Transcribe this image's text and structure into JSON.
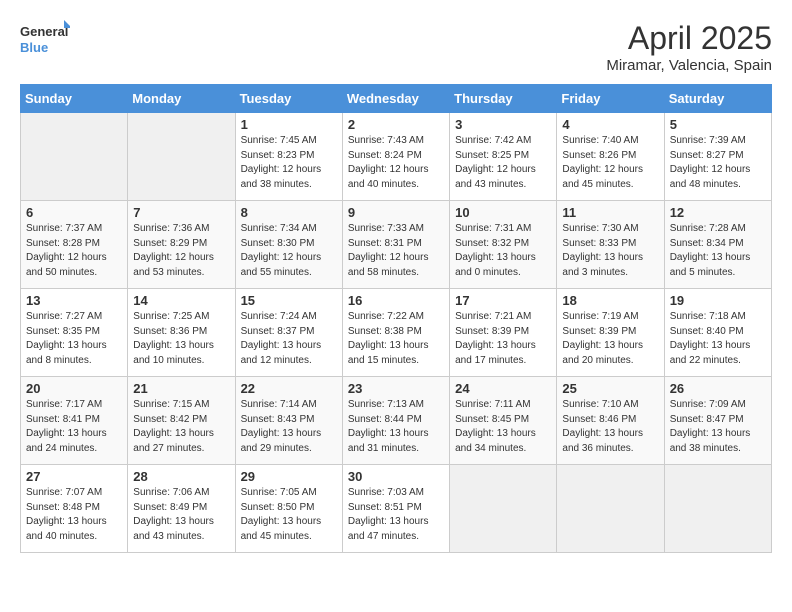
{
  "header": {
    "logo_general": "General",
    "logo_blue": "Blue",
    "month": "April 2025",
    "location": "Miramar, Valencia, Spain"
  },
  "days_of_week": [
    "Sunday",
    "Monday",
    "Tuesday",
    "Wednesday",
    "Thursday",
    "Friday",
    "Saturday"
  ],
  "weeks": [
    [
      {
        "num": "",
        "info": ""
      },
      {
        "num": "",
        "info": ""
      },
      {
        "num": "1",
        "info": "Sunrise: 7:45 AM\nSunset: 8:23 PM\nDaylight: 12 hours and 38 minutes."
      },
      {
        "num": "2",
        "info": "Sunrise: 7:43 AM\nSunset: 8:24 PM\nDaylight: 12 hours and 40 minutes."
      },
      {
        "num": "3",
        "info": "Sunrise: 7:42 AM\nSunset: 8:25 PM\nDaylight: 12 hours and 43 minutes."
      },
      {
        "num": "4",
        "info": "Sunrise: 7:40 AM\nSunset: 8:26 PM\nDaylight: 12 hours and 45 minutes."
      },
      {
        "num": "5",
        "info": "Sunrise: 7:39 AM\nSunset: 8:27 PM\nDaylight: 12 hours and 48 minutes."
      }
    ],
    [
      {
        "num": "6",
        "info": "Sunrise: 7:37 AM\nSunset: 8:28 PM\nDaylight: 12 hours and 50 minutes."
      },
      {
        "num": "7",
        "info": "Sunrise: 7:36 AM\nSunset: 8:29 PM\nDaylight: 12 hours and 53 minutes."
      },
      {
        "num": "8",
        "info": "Sunrise: 7:34 AM\nSunset: 8:30 PM\nDaylight: 12 hours and 55 minutes."
      },
      {
        "num": "9",
        "info": "Sunrise: 7:33 AM\nSunset: 8:31 PM\nDaylight: 12 hours and 58 minutes."
      },
      {
        "num": "10",
        "info": "Sunrise: 7:31 AM\nSunset: 8:32 PM\nDaylight: 13 hours and 0 minutes."
      },
      {
        "num": "11",
        "info": "Sunrise: 7:30 AM\nSunset: 8:33 PM\nDaylight: 13 hours and 3 minutes."
      },
      {
        "num": "12",
        "info": "Sunrise: 7:28 AM\nSunset: 8:34 PM\nDaylight: 13 hours and 5 minutes."
      }
    ],
    [
      {
        "num": "13",
        "info": "Sunrise: 7:27 AM\nSunset: 8:35 PM\nDaylight: 13 hours and 8 minutes."
      },
      {
        "num": "14",
        "info": "Sunrise: 7:25 AM\nSunset: 8:36 PM\nDaylight: 13 hours and 10 minutes."
      },
      {
        "num": "15",
        "info": "Sunrise: 7:24 AM\nSunset: 8:37 PM\nDaylight: 13 hours and 12 minutes."
      },
      {
        "num": "16",
        "info": "Sunrise: 7:22 AM\nSunset: 8:38 PM\nDaylight: 13 hours and 15 minutes."
      },
      {
        "num": "17",
        "info": "Sunrise: 7:21 AM\nSunset: 8:39 PM\nDaylight: 13 hours and 17 minutes."
      },
      {
        "num": "18",
        "info": "Sunrise: 7:19 AM\nSunset: 8:39 PM\nDaylight: 13 hours and 20 minutes."
      },
      {
        "num": "19",
        "info": "Sunrise: 7:18 AM\nSunset: 8:40 PM\nDaylight: 13 hours and 22 minutes."
      }
    ],
    [
      {
        "num": "20",
        "info": "Sunrise: 7:17 AM\nSunset: 8:41 PM\nDaylight: 13 hours and 24 minutes."
      },
      {
        "num": "21",
        "info": "Sunrise: 7:15 AM\nSunset: 8:42 PM\nDaylight: 13 hours and 27 minutes."
      },
      {
        "num": "22",
        "info": "Sunrise: 7:14 AM\nSunset: 8:43 PM\nDaylight: 13 hours and 29 minutes."
      },
      {
        "num": "23",
        "info": "Sunrise: 7:13 AM\nSunset: 8:44 PM\nDaylight: 13 hours and 31 minutes."
      },
      {
        "num": "24",
        "info": "Sunrise: 7:11 AM\nSunset: 8:45 PM\nDaylight: 13 hours and 34 minutes."
      },
      {
        "num": "25",
        "info": "Sunrise: 7:10 AM\nSunset: 8:46 PM\nDaylight: 13 hours and 36 minutes."
      },
      {
        "num": "26",
        "info": "Sunrise: 7:09 AM\nSunset: 8:47 PM\nDaylight: 13 hours and 38 minutes."
      }
    ],
    [
      {
        "num": "27",
        "info": "Sunrise: 7:07 AM\nSunset: 8:48 PM\nDaylight: 13 hours and 40 minutes."
      },
      {
        "num": "28",
        "info": "Sunrise: 7:06 AM\nSunset: 8:49 PM\nDaylight: 13 hours and 43 minutes."
      },
      {
        "num": "29",
        "info": "Sunrise: 7:05 AM\nSunset: 8:50 PM\nDaylight: 13 hours and 45 minutes."
      },
      {
        "num": "30",
        "info": "Sunrise: 7:03 AM\nSunset: 8:51 PM\nDaylight: 13 hours and 47 minutes."
      },
      {
        "num": "",
        "info": ""
      },
      {
        "num": "",
        "info": ""
      },
      {
        "num": "",
        "info": ""
      }
    ]
  ]
}
